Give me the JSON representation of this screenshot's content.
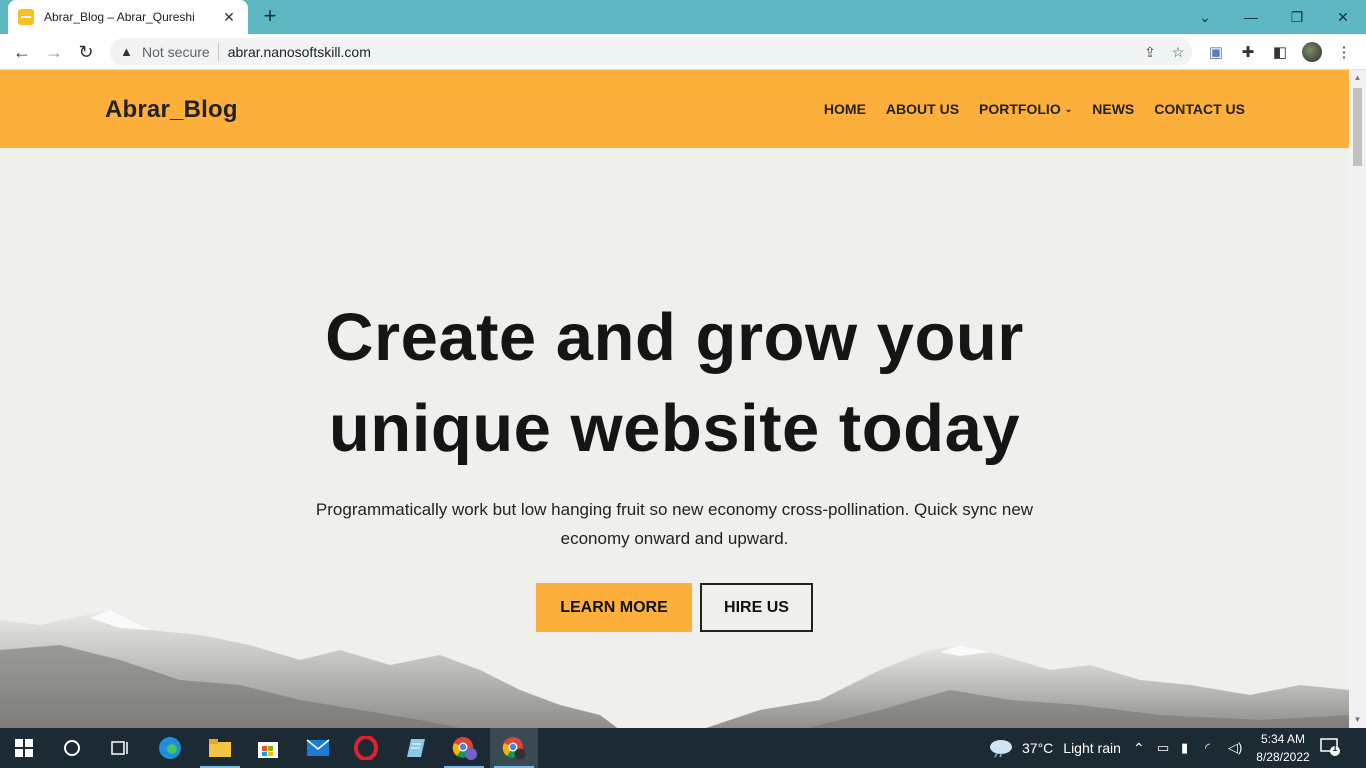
{
  "browser": {
    "tab_title": "Abrar_Blog – Abrar_Qureshi",
    "tab_close": "✕",
    "new_tab": "+",
    "security_label": "Not secure",
    "url": "abrar.nanosoftskill.com"
  },
  "site": {
    "brand": "Abrar_Blog",
    "menu": [
      "HOME",
      "ABOUT US",
      "PORTFOLIO",
      "NEWS",
      "CONTACT US"
    ],
    "hero": {
      "title_line1": "Create and grow your",
      "title_line2": "unique website today",
      "subtitle": "Programmatically work but low hanging fruit so new economy cross-pollination. Quick sync new economy onward and upward.",
      "primary_button": "LEARN MORE",
      "secondary_button": "HIRE US"
    },
    "colors": {
      "accent": "#fcaf3b",
      "background": "#efefec",
      "text": "#151515"
    }
  },
  "taskbar": {
    "weather_temp": "37°C",
    "weather_desc": "Light rain",
    "time": "5:34 AM",
    "date": "8/28/2022",
    "notification_count": "1"
  }
}
